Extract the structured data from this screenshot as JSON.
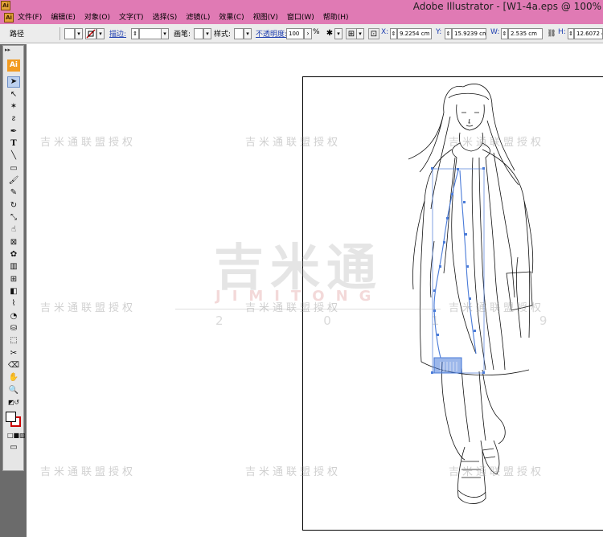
{
  "window": {
    "title": "Adobe Illustrator - [W1-4a.eps @ 100%",
    "icon": "Ai"
  },
  "menu": [
    "文件(F)",
    "编辑(E)",
    "对象(O)",
    "文字(T)",
    "选择(S)",
    "滤镜(L)",
    "效果(C)",
    "视图(V)",
    "窗口(W)",
    "帮助(H)"
  ],
  "control": {
    "object_type": "路径",
    "stroke_label": "描边:",
    "brush_label": "画笔:",
    "style_label": "样式:",
    "opacity_label": "不透明度:",
    "opacity_value": "100",
    "opacity_unit": "%",
    "x_label": "X:",
    "x_value": "9.2254 cm",
    "y_label": "Y:",
    "y_value": "15.9239 cm",
    "w_label": "W:",
    "w_value": "2.535 cm",
    "h_label": "H:",
    "h_value": "12.6072 cm"
  },
  "toolbox": {
    "logo": "Ai",
    "tools": [
      "selection-tool",
      "direct-selection-tool",
      "magic-wand-tool",
      "lasso-tool",
      "pen-tool",
      "type-tool",
      "line-segment-tool",
      "rectangle-tool",
      "paintbrush-tool",
      "pencil-tool",
      "rotate-tool",
      "scale-tool",
      "warp-tool",
      "free-transform-tool",
      "symbol-sprayer-tool",
      "column-graph-tool",
      "mesh-tool",
      "gradient-tool",
      "eyedropper-tool",
      "blend-tool",
      "live-paint-bucket-tool",
      "live-paint-selection-tool",
      "slice-tool",
      "eraser-tool",
      "hand-tool",
      "zoom-tool"
    ]
  },
  "watermark": {
    "text": "吉米通联盟授权",
    "logo": "吉米通",
    "sub": "JIMITONG",
    "year": "2 0 1 9"
  },
  "colors": {
    "title_bar": "#e07ab4",
    "selection": "#4a7bd8",
    "stroke_indicator": "#cc0000"
  }
}
